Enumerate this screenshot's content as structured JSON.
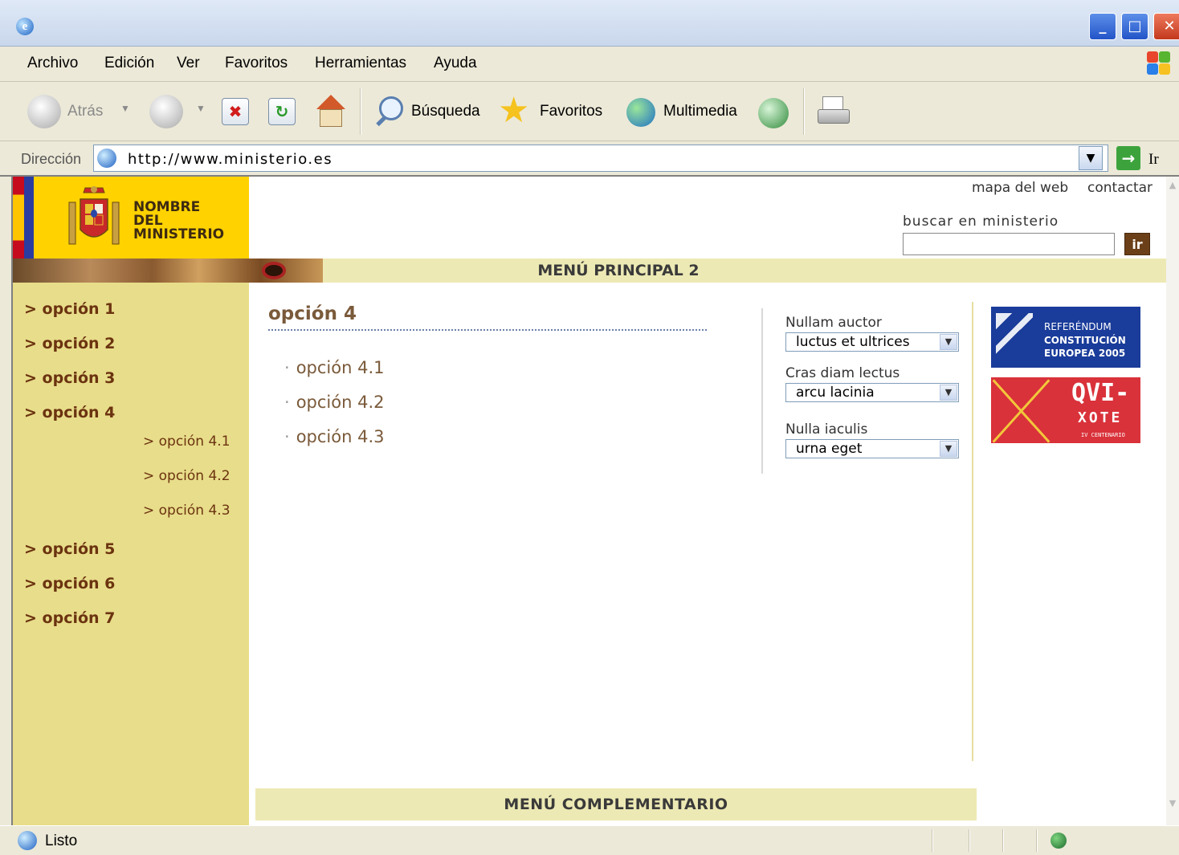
{
  "browser": {
    "menu": [
      "Archivo",
      "Edición",
      "Ver",
      "Favoritos",
      "Herramientas",
      "Ayuda"
    ],
    "toolbar": {
      "back": "Atrás",
      "search": "Búsqueda",
      "favorites": "Favoritos",
      "media": "Multimedia"
    },
    "address": {
      "label": "Dirección",
      "url": "http://www.ministerio.es",
      "go": "Ir"
    },
    "status": "Listo"
  },
  "site": {
    "ministry_name": [
      "NOMBRE",
      "DEL",
      "MINISTERIO"
    ],
    "top_links": [
      "mapa del web",
      "contactar"
    ],
    "search": {
      "label": "buscar en ministerio",
      "value": "",
      "button": "ir"
    },
    "main_menu_label": "MENÚ PRINCIPAL 2",
    "nav": {
      "items": [
        "> opción 1",
        "> opción 2",
        "> opción 3",
        "> opción 4",
        "> opción 5",
        "> opción 6",
        "> opción 7"
      ],
      "subitems": [
        "> opción 4.1",
        "> opción 4.2",
        "> opción 4.3"
      ]
    },
    "content": {
      "title": "opción 4",
      "links": [
        "opción 4.1",
        "opción 4.2",
        "opción 4.3"
      ]
    },
    "selects": [
      {
        "label": "Nullam auctor",
        "value": "luctus et ultrices"
      },
      {
        "label": "Cras diam lectus",
        "value": "arcu lacinia"
      },
      {
        "label": "Nulla iaculis",
        "value": "urna eget"
      }
    ],
    "ads": {
      "referendum": [
        "REFERÉNDUM",
        "CONSTITUCIÓN",
        "EUROPEA 2005"
      ],
      "quijote": [
        "QVI-",
        "XOTE",
        "IV CENTENARIO"
      ]
    },
    "complementary_menu_label": "MENÚ COMPLEMENTARIO"
  }
}
